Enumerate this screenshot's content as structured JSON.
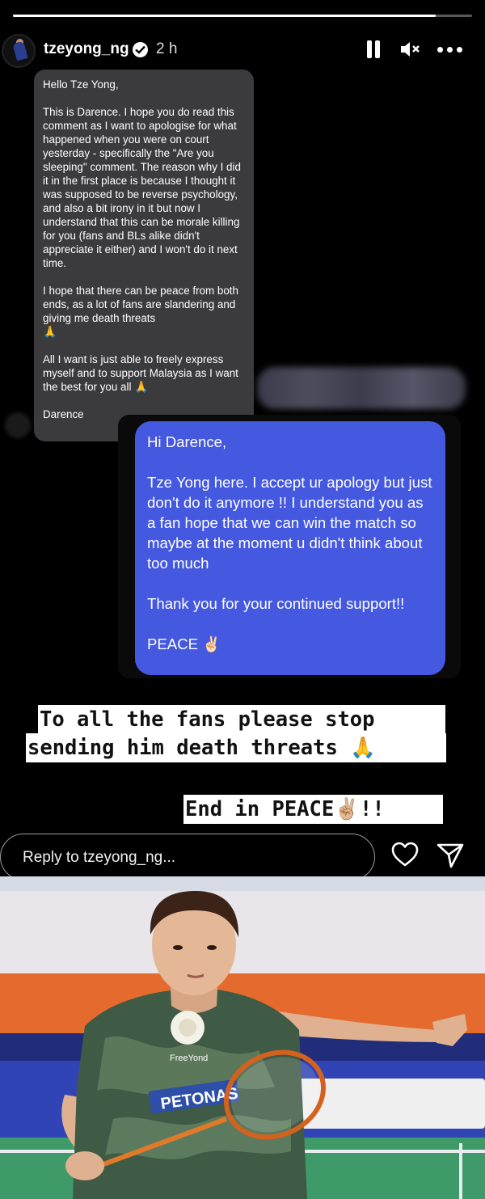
{
  "story": {
    "progress": 0.92,
    "username": "tzeyong_ng",
    "time_ago": "2 h"
  },
  "dm": {
    "paragraphs": [
      "Hello Tze Yong,",
      "This is Darence. I hope you do read this comment as I want to apologise for what happened when you were on court yesterday - specifically the \"Are you sleeping\" comment. The reason why I did it in the first place is because I thought it was supposed to be reverse psychology, and also a bit irony in it but now I understand that this can be morale killing for you (fans and BLs alike didn't appreciate it either) and I won't do it next time.",
      "I hope that there can be peace from both ends, as a lot of fans are slandering and giving me death threats",
      "All I want is just able to freely express myself and to support Malaysia as I want the best for you all",
      "Darence"
    ],
    "emoji": "🙏"
  },
  "reply": {
    "paragraphs": [
      "Hi Darence,",
      "Tze Yong here. I accept ur apology but just don't do it anymore !! I understand you as a fan hope that we can win the match so maybe at the moment u didn't think about too much",
      "Thank you for your continued support!!",
      "PEACE ✌🏻"
    ]
  },
  "stickers": {
    "line1": "To all the fans please stop",
    "line2": "sending him death threats 🙏",
    "line3": "End in PEACE✌🏼!!"
  },
  "reply_bar": {
    "placeholder": "Reply to tzeyong_ng..."
  },
  "photo": {
    "shirt_text": "PETONAS",
    "brand_text": "FreeYond"
  },
  "colors": {
    "reply_bubble": "#4458e0",
    "dm_bubble": "#3b3b3d",
    "court_wall": "#3044b5",
    "banner_orange": "#e56a2d"
  }
}
